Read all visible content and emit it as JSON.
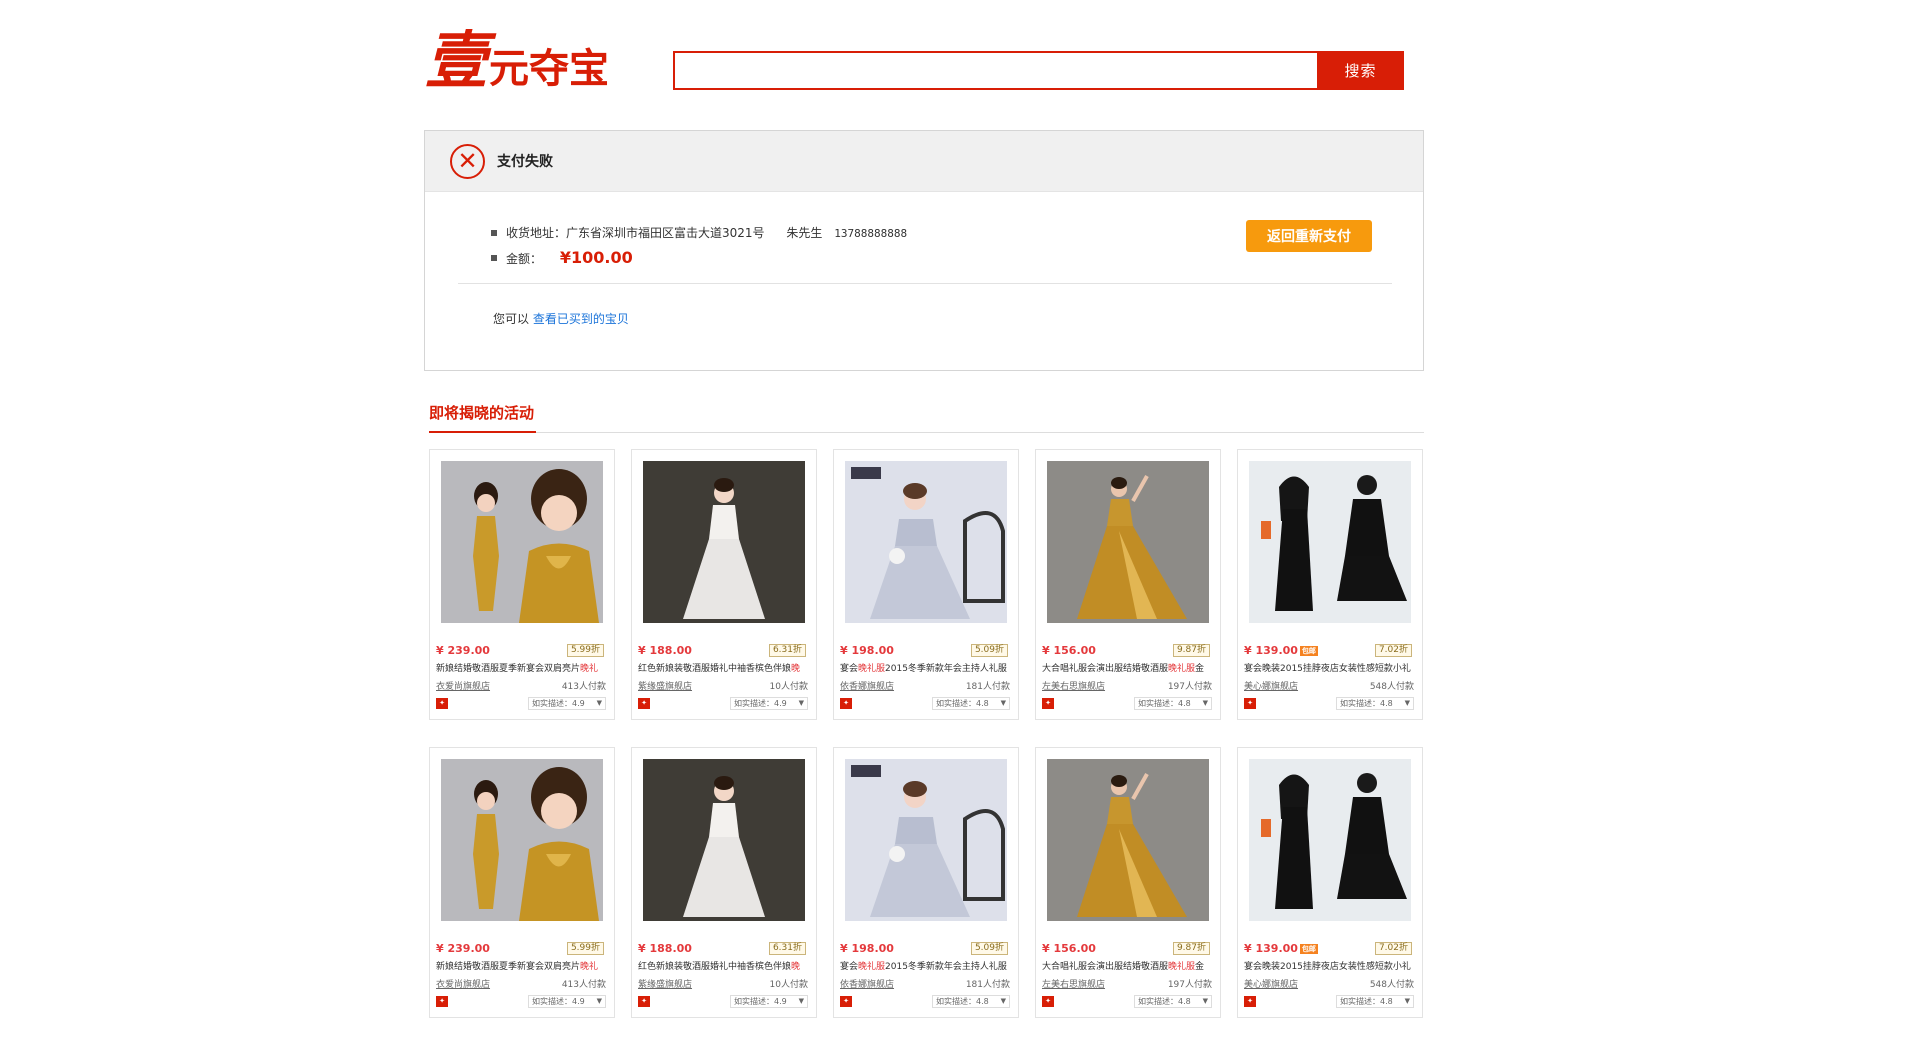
{
  "logo": {
    "big": "壹",
    "small": "元夺宝"
  },
  "search": {
    "placeholder": "",
    "value": "",
    "button_label": "搜索"
  },
  "status": {
    "title": "支付失败",
    "address_label": "收货地址：",
    "address": "广东省深圳市福田区富击大道3021号",
    "recipient": "朱先生",
    "phone": "13788888888",
    "amount_label": "金额：",
    "amount": "¥100.00",
    "repay_button": "返回重新支付",
    "hint_prefix": "您可以",
    "hint_link": "查看已买到的宝贝"
  },
  "section": {
    "title": "即将揭晓的活动"
  },
  "icons": {
    "fail": "close-circle-icon",
    "shop_mark": "tmall-icon",
    "dropdown": "chevron-down-icon"
  },
  "colors": {
    "brand": "#d81e06",
    "button_orange": "#f79a0d",
    "link": "#1a73d9"
  },
  "products": [
    {
      "price": "¥ 239.00",
      "discount": "5.99折",
      "title_pre": "新娘结婚敬酒服夏季新宴会双肩亮片",
      "title_hl": "晚礼",
      "title_post": "",
      "shop": "衣爱尚旗舰店",
      "sales": "413人付款",
      "rating": "如实描述：4.9",
      "dress": "gold",
      "tag": ""
    },
    {
      "price": "¥ 188.00",
      "discount": "6.31折",
      "title_pre": "红色新娘装敬酒服婚礼中袖香槟色伴娘",
      "title_hl": "晚",
      "title_post": "",
      "shop": "紫缘盛旗舰店",
      "sales": "10人付款",
      "rating": "如实描述：4.9",
      "dress": "white",
      "tag": ""
    },
    {
      "price": "¥ 198.00",
      "discount": "5.09折",
      "title_pre": "宴会",
      "title_hl": "晚礼服",
      "title_post": "2015冬季新款年会主持人礼服",
      "shop": "依香娜旗舰店",
      "sales": "181人付款",
      "rating": "如实描述：4.8",
      "dress": "lavender",
      "tag": ""
    },
    {
      "price": "¥ 156.00",
      "discount": "9.87折",
      "title_pre": "大合唱礼服会演出服结婚敬酒服",
      "title_hl": "晚礼服",
      "title_post": "金",
      "shop": "左美右思旗舰店",
      "sales": "197人付款",
      "rating": "如实描述：4.8",
      "dress": "goldsatin",
      "tag": ""
    },
    {
      "price": "¥ 139.00",
      "discount": "7.02折",
      "title_pre": "宴会晚装2015挂脖夜店女装性感短款小礼",
      "title_hl": "",
      "title_post": "",
      "shop": "美心娜旗舰店",
      "sales": "548人付款",
      "rating": "如实描述：4.8",
      "dress": "black",
      "tag": "包邮"
    },
    {
      "price": "¥ 239.00",
      "discount": "5.99折",
      "title_pre": "新娘结婚敬酒服夏季新宴会双肩亮片",
      "title_hl": "晚礼",
      "title_post": "",
      "shop": "衣爱尚旗舰店",
      "sales": "413人付款",
      "rating": "如实描述：4.9",
      "dress": "gold",
      "tag": ""
    },
    {
      "price": "¥ 188.00",
      "discount": "6.31折",
      "title_pre": "红色新娘装敬酒服婚礼中袖香槟色伴娘",
      "title_hl": "晚",
      "title_post": "",
      "shop": "紫缘盛旗舰店",
      "sales": "10人付款",
      "rating": "如实描述：4.9",
      "dress": "white",
      "tag": ""
    },
    {
      "price": "¥ 198.00",
      "discount": "5.09折",
      "title_pre": "宴会",
      "title_hl": "晚礼服",
      "title_post": "2015冬季新款年会主持人礼服",
      "shop": "依香娜旗舰店",
      "sales": "181人付款",
      "rating": "如实描述：4.8",
      "dress": "lavender",
      "tag": ""
    },
    {
      "price": "¥ 156.00",
      "discount": "9.87折",
      "title_pre": "大合唱礼服会演出服结婚敬酒服",
      "title_hl": "晚礼服",
      "title_post": "金",
      "shop": "左美右思旗舰店",
      "sales": "197人付款",
      "rating": "如实描述：4.8",
      "dress": "goldsatin",
      "tag": ""
    },
    {
      "price": "¥ 139.00",
      "discount": "7.02折",
      "title_pre": "宴会晚装2015挂脖夜店女装性感短款小礼",
      "title_hl": "",
      "title_post": "",
      "shop": "美心娜旗舰店",
      "sales": "548人付款",
      "rating": "如实描述：4.8",
      "dress": "black",
      "tag": "包邮"
    }
  ]
}
